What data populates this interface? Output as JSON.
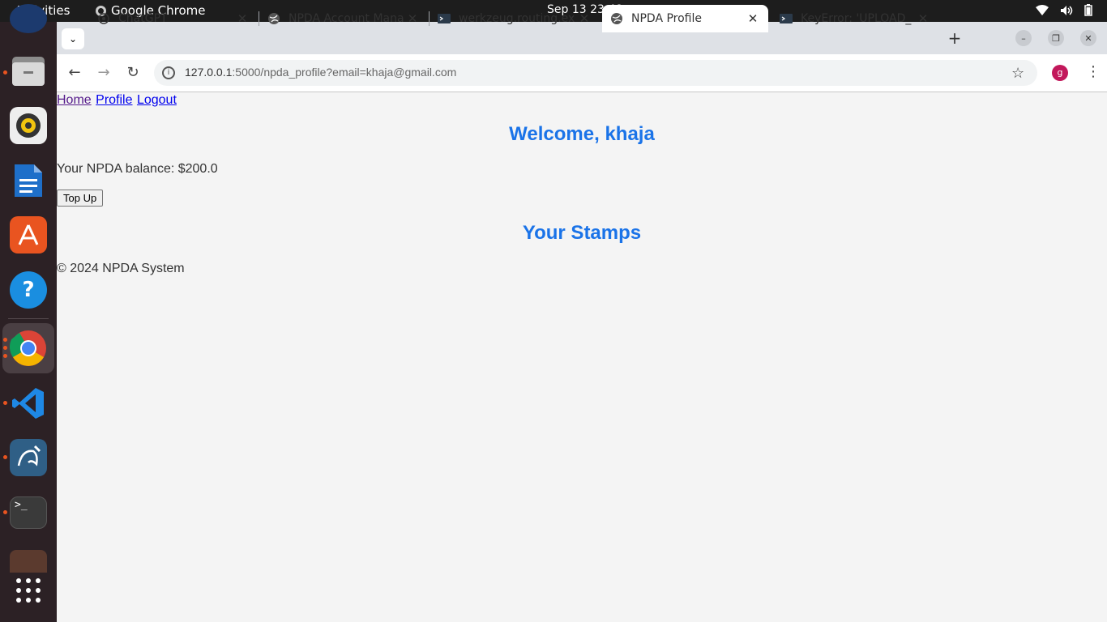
{
  "system": {
    "activities": "Activities",
    "app_name": "Google Chrome",
    "clock": "Sep 13  23:48"
  },
  "browser": {
    "tabs": [
      {
        "title": "ChatGPT",
        "favicon": "chatgpt-icon"
      },
      {
        "title": "NPDA Account Mana",
        "favicon": "globe-icon"
      },
      {
        "title": "werkzeug.routing.ex",
        "favicon": "terminal-icon"
      },
      {
        "title": "NPDA Profile",
        "favicon": "globe-icon",
        "active": true
      },
      {
        "title": "KeyError: 'UPLOAD_",
        "favicon": "terminal-icon"
      }
    ],
    "url_host": "127.0.0.1",
    "url_rest": ":5000/npda_profile?email=khaja@gmail.com",
    "profile_initial": "g",
    "profile_color": "#c2185b"
  },
  "page": {
    "nav": [
      {
        "label": "Home"
      },
      {
        "label": "Profile"
      },
      {
        "label": "Logout"
      }
    ],
    "welcome": "Welcome, khaja",
    "balance_text": "Your NPDA balance: $200.0",
    "topup_label": "Top Up",
    "stamps_heading": "Your Stamps",
    "footer": "© 2024 NPDA System",
    "accent_color": "#1a73e8"
  },
  "dock": [
    "files-icon",
    "rhythmbox-icon",
    "writer-icon",
    "app-center-icon",
    "help-icon",
    "chrome-icon",
    "vscode-icon",
    "mysql-workbench-icon",
    "terminal-icon",
    "disk-icon",
    "show-apps-icon"
  ]
}
